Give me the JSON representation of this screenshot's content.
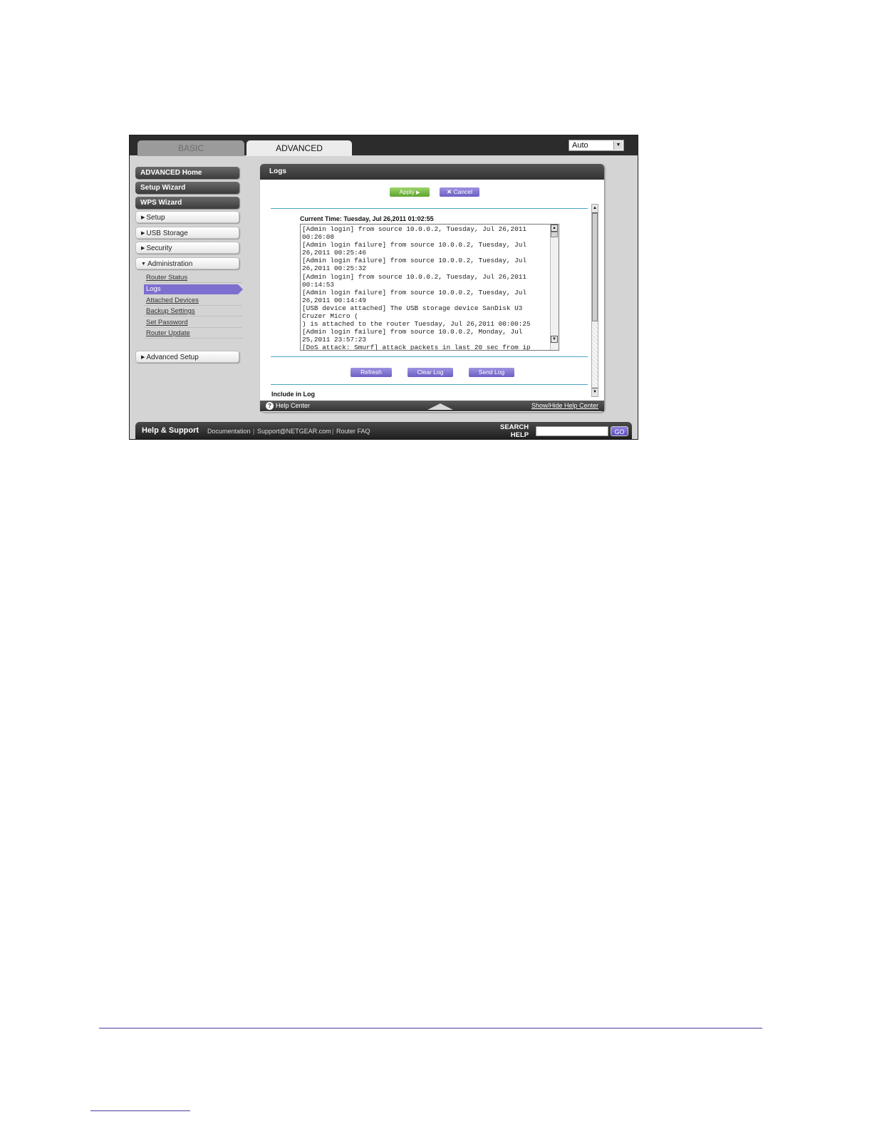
{
  "tabs": {
    "basic": "BASIC",
    "advanced": "ADVANCED"
  },
  "language_select": {
    "value": "Auto"
  },
  "sidebar": {
    "advanced_home": "ADVANCED Home",
    "setup_wizard": "Setup Wizard",
    "wps_wizard": "WPS Wizard",
    "setup": "Setup",
    "usb_storage": "USB Storage",
    "security": "Security",
    "administration": "Administration",
    "admin_items": [
      "Router Status",
      "Logs",
      "Attached Devices",
      "Backup Settings",
      "Set Password",
      "Router Update"
    ],
    "advanced_setup": "Advanced Setup"
  },
  "panel": {
    "title": "Logs",
    "apply": "Apply",
    "cancel": "Cancel",
    "current_time": "Current Time: Tuesday, Jul 26,2011 01:02:55",
    "log_text": "[Admin login] from source 10.0.0.2, Tuesday, Jul 26,2011\n00:26:08\n[Admin login failure] from source 10.0.0.2, Tuesday, Jul\n26,2011 00:25:46\n[Admin login failure] from source 10.0.0.2, Tuesday, Jul\n26,2011 00:25:32\n[Admin login] from source 10.0.0.2, Tuesday, Jul 26,2011\n00:14:53\n[Admin login failure] from source 10.0.0.2, Tuesday, Jul\n26,2011 00:14:49\n[USB device attached] The USB storage device SanDisk U3\nCruzer Micro (\n) is attached to the router Tuesday, Jul 26,2011 00:00:25\n[Admin login failure] from source 10.0.0.2, Monday, Jul\n25,2011 23:57:23\n[DoS attack: Smurf] attack packets in last 20 sec from ip",
    "refresh": "Refresh",
    "clear_log": "Clear Log",
    "send_log": "Send Log",
    "include_in_log": "Include in Log"
  },
  "help_bar": {
    "help_center": "Help Center",
    "show_hide": "Show/Hide Help Center"
  },
  "footer": {
    "help_support": "Help & Support",
    "documentation": "Documentation",
    "support_email": "Support@NETGEAR.com",
    "router_faq": "Router FAQ",
    "search_line1": "SEARCH",
    "search_line2": "HELP",
    "go": "GO"
  }
}
